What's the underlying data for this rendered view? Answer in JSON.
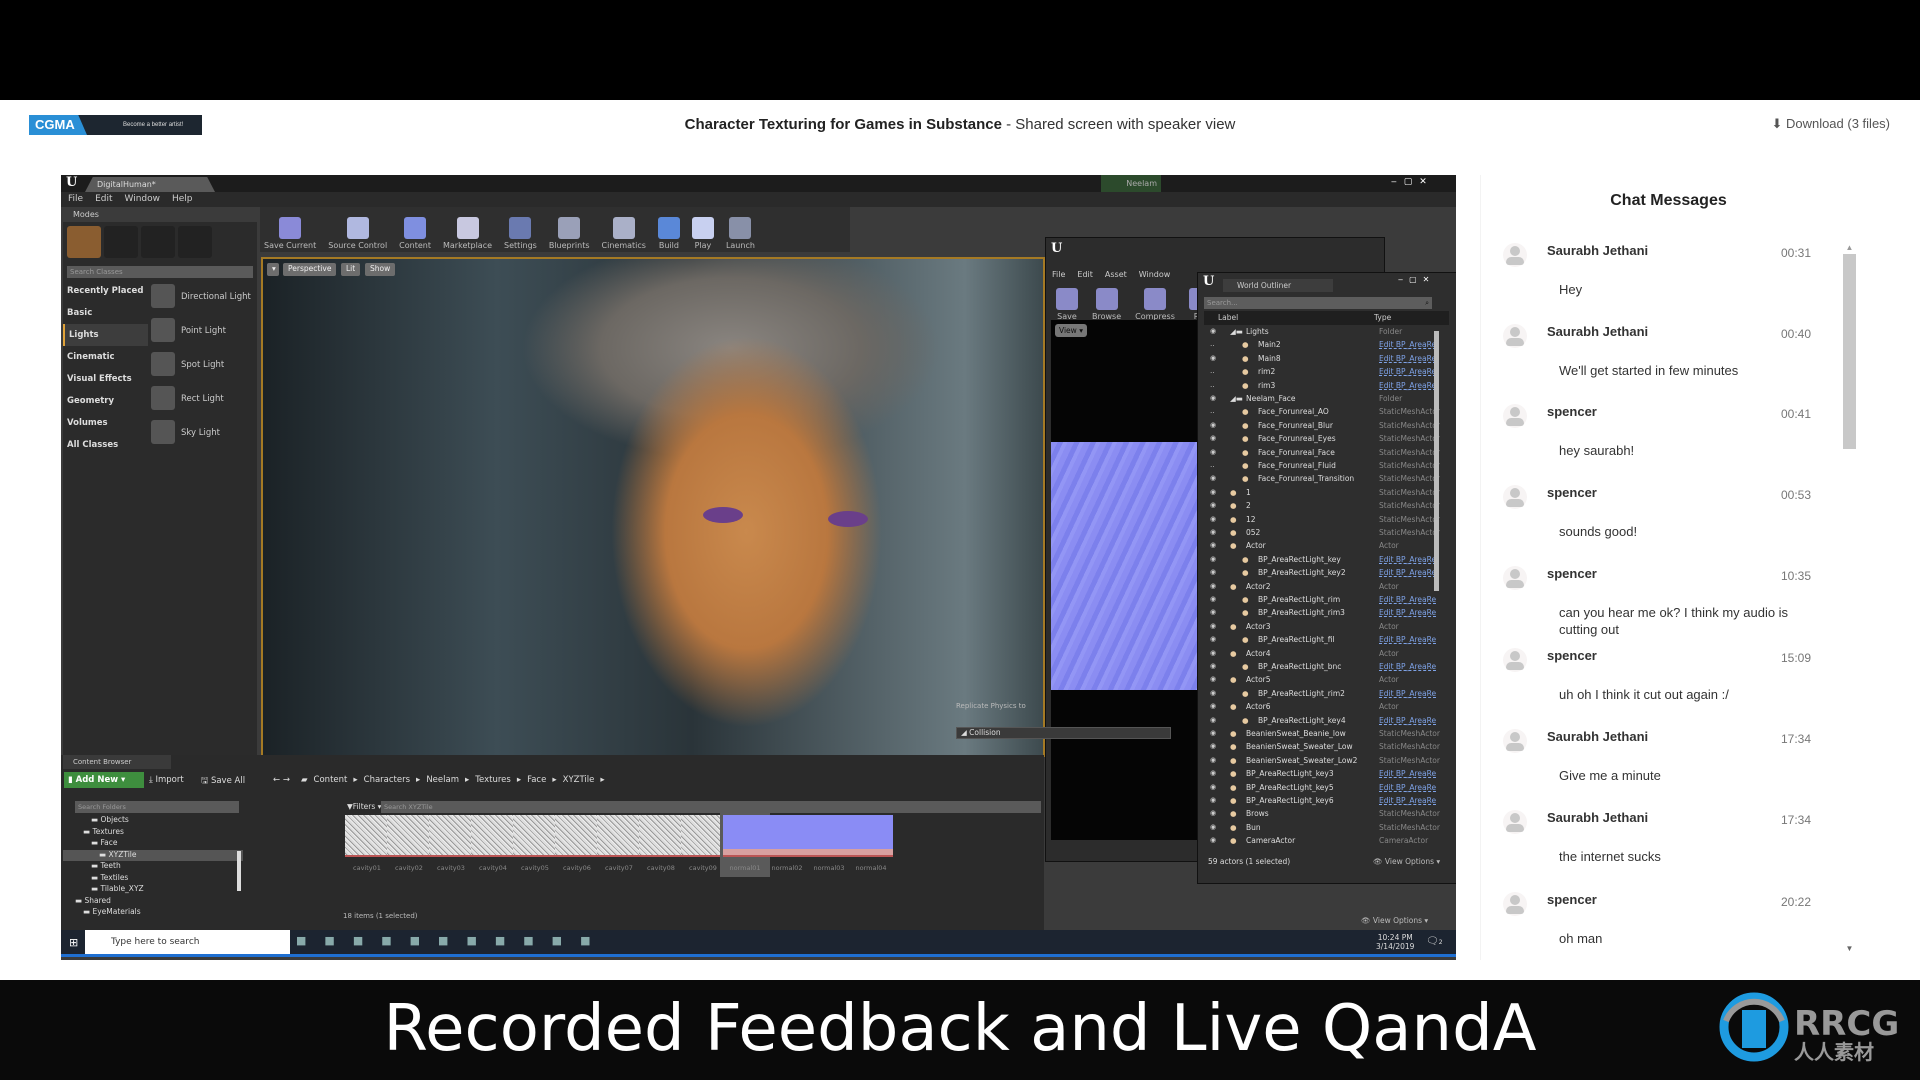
{
  "header": {
    "logo_text": "CGMA",
    "logo_tagline": "Become a better artist!",
    "course_title": "Character Texturing for Games in Substance",
    "subtitle": " - Shared screen with speaker view",
    "download_label": "Download (3 files)"
  },
  "ue": {
    "tab_title": "DigitalHuman*",
    "user": "Neelam",
    "menu": [
      "File",
      "Edit",
      "Window",
      "Help"
    ],
    "modes_tab": "Modes",
    "search_classes_placeholder": "Search Classes",
    "categories": [
      "Recently Placed",
      "Basic",
      "Lights",
      "Cinematic",
      "Visual Effects",
      "Geometry",
      "Volumes",
      "All Classes"
    ],
    "selected_category": "Lights",
    "lights": [
      "Directional Light",
      "Point Light",
      "Spot Light",
      "Rect Light",
      "Sky Light"
    ],
    "toolbar": [
      "Save Current",
      "Source Control",
      "Content",
      "Marketplace",
      "Settings",
      "Blueprints",
      "Cinematics",
      "Build",
      "Play",
      "Launch"
    ],
    "viewport_buttons": [
      "Perspective",
      "Lit",
      "Show"
    ],
    "texture_editor": {
      "menu": [
        "File",
        "Edit",
        "Asset",
        "Window"
      ],
      "toolbar": [
        "Save",
        "Browse",
        "Compress",
        "Rei"
      ],
      "view_button": "View",
      "replicate_label": "Replicate Physics to",
      "collision_label": "Collision",
      "view_options": "View Options"
    },
    "outliner": {
      "tab": "World Outliner",
      "search_placeholder": "Search...",
      "col_label": "Label",
      "col_type": "Type",
      "footer": "59 actors (1 selected)",
      "view_options": "View Options",
      "rows": [
        {
          "label": "Lights",
          "type": "Folder",
          "indent": 1,
          "eye": true,
          "link": false
        },
        {
          "label": "Main2",
          "type": "Edit BP_AreaRe",
          "indent": 2,
          "eye": false,
          "link": true
        },
        {
          "label": "Main8",
          "type": "Edit BP_AreaRe",
          "indent": 2,
          "eye": true,
          "link": true
        },
        {
          "label": "rim2",
          "type": "Edit BP_AreaRe",
          "indent": 2,
          "eye": false,
          "link": true
        },
        {
          "label": "rim3",
          "type": "Edit BP_AreaRe",
          "indent": 2,
          "eye": false,
          "link": true
        },
        {
          "label": "Neelam_Face",
          "type": "Folder",
          "indent": 1,
          "eye": true,
          "link": false
        },
        {
          "label": "Face_Forunreal_AO",
          "type": "StaticMeshActor",
          "indent": 2,
          "eye": false,
          "link": false
        },
        {
          "label": "Face_Forunreal_Blur",
          "type": "StaticMeshActor",
          "indent": 2,
          "eye": true,
          "link": false
        },
        {
          "label": "Face_Forunreal_Eyes",
          "type": "StaticMeshActor",
          "indent": 2,
          "eye": true,
          "link": false
        },
        {
          "label": "Face_Forunreal_Face",
          "type": "StaticMeshActor",
          "indent": 2,
          "eye": true,
          "link": false
        },
        {
          "label": "Face_Forunreal_Fluid",
          "type": "StaticMeshActor",
          "indent": 2,
          "eye": false,
          "link": false
        },
        {
          "label": "Face_Forunreal_Transition",
          "type": "StaticMeshActor",
          "indent": 2,
          "eye": true,
          "link": false
        },
        {
          "label": "1",
          "type": "StaticMeshActor",
          "indent": 1,
          "eye": true,
          "link": false
        },
        {
          "label": "2",
          "type": "StaticMeshActor",
          "indent": 1,
          "eye": true,
          "link": false
        },
        {
          "label": "12",
          "type": "StaticMeshActor",
          "indent": 1,
          "eye": true,
          "link": false
        },
        {
          "label": "052",
          "type": "StaticMeshActor",
          "indent": 1,
          "eye": true,
          "link": false
        },
        {
          "label": "Actor",
          "type": "Actor",
          "indent": 1,
          "eye": true,
          "link": false
        },
        {
          "label": "BP_AreaRectLight_key",
          "type": "Edit BP_AreaRe",
          "indent": 2,
          "eye": true,
          "link": true
        },
        {
          "label": "BP_AreaRectLight_key2",
          "type": "Edit BP_AreaRe",
          "indent": 2,
          "eye": true,
          "link": true
        },
        {
          "label": "Actor2",
          "type": "Actor",
          "indent": 1,
          "eye": true,
          "link": false
        },
        {
          "label": "BP_AreaRectLight_rim",
          "type": "Edit BP_AreaRe",
          "indent": 2,
          "eye": true,
          "link": true
        },
        {
          "label": "BP_AreaRectLight_rim3",
          "type": "Edit BP_AreaRe",
          "indent": 2,
          "eye": true,
          "link": true
        },
        {
          "label": "Actor3",
          "type": "Actor",
          "indent": 1,
          "eye": true,
          "link": false
        },
        {
          "label": "BP_AreaRectLight_fil",
          "type": "Edit BP_AreaRe",
          "indent": 2,
          "eye": true,
          "link": true
        },
        {
          "label": "Actor4",
          "type": "Actor",
          "indent": 1,
          "eye": true,
          "link": false
        },
        {
          "label": "BP_AreaRectLight_bnc",
          "type": "Edit BP_AreaRe",
          "indent": 2,
          "eye": true,
          "link": true
        },
        {
          "label": "Actor5",
          "type": "Actor",
          "indent": 1,
          "eye": true,
          "link": false
        },
        {
          "label": "BP_AreaRectLight_rim2",
          "type": "Edit BP_AreaRe",
          "indent": 2,
          "eye": true,
          "link": true
        },
        {
          "label": "Actor6",
          "type": "Actor",
          "indent": 1,
          "eye": true,
          "link": false
        },
        {
          "label": "BP_AreaRectLight_key4",
          "type": "Edit BP_AreaRe",
          "indent": 2,
          "eye": true,
          "link": true
        },
        {
          "label": "BeanienSweat_Beanie_low",
          "type": "StaticMeshActor",
          "indent": 1,
          "eye": true,
          "link": false
        },
        {
          "label": "BeanienSweat_Sweater_Low",
          "type": "StaticMeshActor",
          "indent": 1,
          "eye": true,
          "link": false
        },
        {
          "label": "BeanienSweat_Sweater_Low2",
          "type": "StaticMeshActor",
          "indent": 1,
          "eye": true,
          "link": false
        },
        {
          "label": "BP_AreaRectLight_key3",
          "type": "Edit BP_AreaRe",
          "indent": 1,
          "eye": true,
          "link": true
        },
        {
          "label": "BP_AreaRectLight_key5",
          "type": "Edit BP_AreaRe",
          "indent": 1,
          "eye": true,
          "link": true
        },
        {
          "label": "BP_AreaRectLight_key6",
          "type": "Edit BP_AreaRe",
          "indent": 1,
          "eye": true,
          "link": true
        },
        {
          "label": "Brows",
          "type": "StaticMeshActor",
          "indent": 1,
          "eye": true,
          "link": false
        },
        {
          "label": "Bun",
          "type": "StaticMeshActor",
          "indent": 1,
          "eye": true,
          "link": false
        },
        {
          "label": "CameraActor",
          "type": "CameraActor",
          "indent": 1,
          "eye": true,
          "link": false
        }
      ]
    },
    "content_browser": {
      "tab": "Content Browser",
      "add_new": "Add New",
      "import": "Import",
      "save_all": "Save All",
      "path": [
        "Content",
        "Characters",
        "Neelam",
        "Textures",
        "Face",
        "XYZTile"
      ],
      "search_folders_placeholder": "Search Folders",
      "filters": "Filters",
      "search_placeholder": "Search XYZTile",
      "folders": [
        {
          "name": "Objects",
          "indent": 2
        },
        {
          "name": "Textures",
          "indent": 1
        },
        {
          "name": "Face",
          "indent": 2
        },
        {
          "name": "XYZTile",
          "indent": 3,
          "selected": true
        },
        {
          "name": "Teeth",
          "indent": 2
        },
        {
          "name": "Textiles",
          "indent": 2
        },
        {
          "name": "Tilable_XYZ",
          "indent": 2
        },
        {
          "name": "Shared",
          "indent": 0
        },
        {
          "name": "EyeMaterials",
          "indent": 1
        }
      ],
      "assets": [
        {
          "name": "cavity01",
          "kind": "cavity"
        },
        {
          "name": "cavity02",
          "kind": "cavity"
        },
        {
          "name": "cavity03",
          "kind": "cavity"
        },
        {
          "name": "cavity04",
          "kind": "cavity"
        },
        {
          "name": "cavity05",
          "kind": "cavity"
        },
        {
          "name": "cavity06",
          "kind": "cavity"
        },
        {
          "name": "cavity07",
          "kind": "cavity"
        },
        {
          "name": "cavity08",
          "kind": "cavity"
        },
        {
          "name": "cavity09",
          "kind": "cavity"
        },
        {
          "name": "normal01",
          "kind": "normal",
          "selected": true
        },
        {
          "name": "normal02",
          "kind": "normal"
        },
        {
          "name": "normal03",
          "kind": "normal"
        },
        {
          "name": "normal04",
          "kind": "normal"
        }
      ],
      "status": "18 items (1 selected)",
      "view_options": "View Options"
    },
    "taskbar": {
      "search_placeholder": "Type here to search",
      "time": "10:24 PM",
      "date": "3/14/2019",
      "notifications": "2"
    }
  },
  "chat": {
    "title": "Chat Messages",
    "messages": [
      {
        "name": "Saurabh Jethani",
        "time": "00:31",
        "text": "Hey"
      },
      {
        "name": "Saurabh Jethani",
        "time": "00:40",
        "text": "We'll get started in few minutes"
      },
      {
        "name": "spencer",
        "time": "00:41",
        "text": "hey saurabh!"
      },
      {
        "name": "spencer",
        "time": "00:53",
        "text": "sounds good!"
      },
      {
        "name": "spencer",
        "time": "10:35",
        "text": "can you hear me ok? I think my audio is cutting out"
      },
      {
        "name": "spencer",
        "time": "15:09",
        "text": "uh oh I think it cut out again :/"
      },
      {
        "name": "Saurabh Jethani",
        "time": "17:34",
        "text": "Give me a minute"
      },
      {
        "name": "Saurabh Jethani",
        "time": "17:34",
        "text": "the internet sucks"
      },
      {
        "name": "spencer",
        "time": "20:22",
        "text": "oh man"
      }
    ]
  },
  "banner": {
    "text": "Recorded Feedback and Live QandA",
    "watermark": "RRCG 人人素材"
  },
  "colors": {
    "accent_orange": "#e0a33a",
    "link_blue": "#7ea2e6",
    "add_new_green": "#3e8e3e",
    "cgma_blue": "#2a8fd6",
    "rrcg_blue": "#1e9be0"
  }
}
